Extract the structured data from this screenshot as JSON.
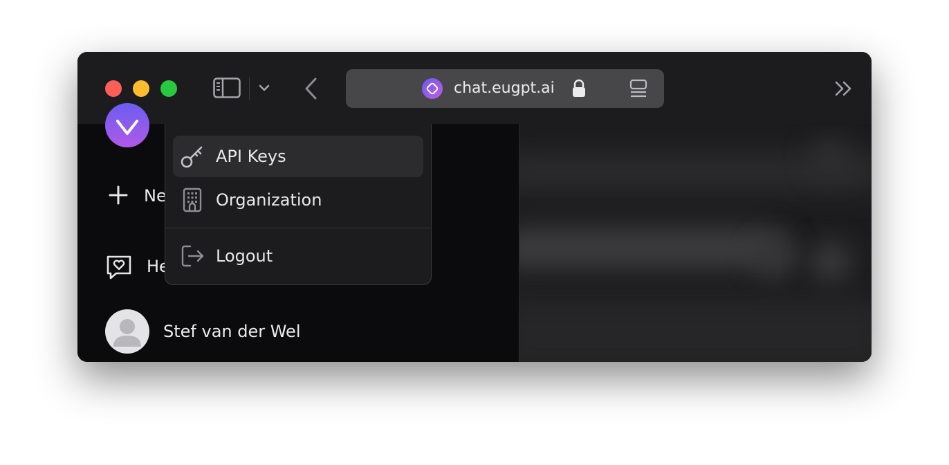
{
  "browser": {
    "url": "chat.eugpt.ai",
    "icons": {
      "sidebar_toggle": "sidebar-icon",
      "chevron": "chevron-down-icon",
      "back": "back-chevron-icon",
      "site": "site-favicon",
      "lock": "lock-icon",
      "reader": "reader-icon",
      "overflow": "chevron-double-right-icon"
    }
  },
  "sidebar": {
    "new_label": "Ne",
    "help_label": "He",
    "user_name": "Stef van der Wel"
  },
  "menu": {
    "items": [
      {
        "label": "API Keys",
        "icon": "key-icon"
      },
      {
        "label": "Organization",
        "icon": "building-icon"
      },
      {
        "label": "Logout",
        "icon": "logout-icon"
      }
    ]
  },
  "colors": {
    "accent_start": "#6a5cf0",
    "accent_end": "#b05ae8",
    "traffic_red": "#fe5f57",
    "traffic_yellow": "#febc2e",
    "traffic_green": "#28c840"
  }
}
